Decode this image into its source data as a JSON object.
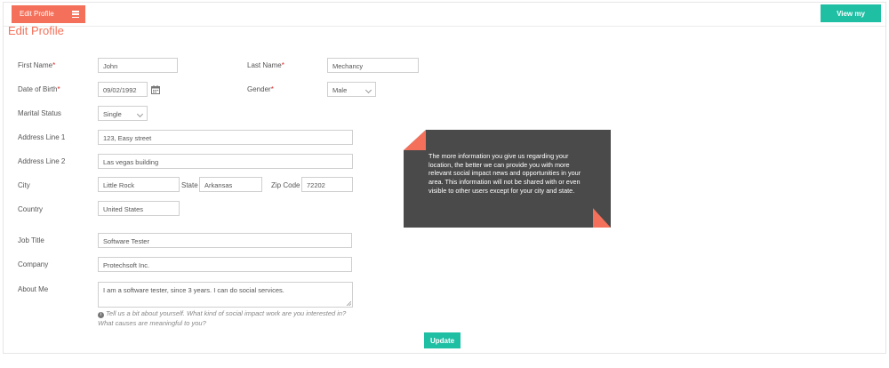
{
  "header": {
    "tab_label": "Edit Profile",
    "view_profile_label": "View my profile"
  },
  "page": {
    "title": "Edit Profile"
  },
  "form": {
    "first_name": {
      "label": "First Name",
      "value": "John"
    },
    "last_name": {
      "label": "Last Name",
      "value": "Mechancy"
    },
    "dob": {
      "label": "Date of Birth",
      "value": "09/02/1992"
    },
    "gender": {
      "label": "Gender",
      "value": "Male"
    },
    "marital": {
      "label": "Marital Status",
      "value": "Single"
    },
    "address1": {
      "label": "Address Line 1",
      "value": "123, Easy street"
    },
    "address2": {
      "label": "Address Line 2",
      "value": "Las vegas building"
    },
    "city": {
      "label": "City",
      "value": "Little Rock"
    },
    "state": {
      "label": "State",
      "value": "Arkansas"
    },
    "zip": {
      "label": "Zip Code",
      "value": "72202"
    },
    "country": {
      "label": "Country",
      "value": "United States"
    },
    "job_title": {
      "label": "Job Title",
      "value": "Software Tester"
    },
    "company": {
      "label": "Company",
      "value": "Protechsoft Inc."
    },
    "about": {
      "label": "About Me",
      "value": "I am a software tester, since 3 years. I can do social services."
    },
    "hint_line1": "Tell us a bit about yourself. What kind of social impact work are you interested in?",
    "hint_line2": "What causes are meaningful to you?",
    "required_mark": "*"
  },
  "note": {
    "text": "The more information you give us regarding your location, the better we can provide you with more relevant social impact news and opportunities in your area. This information will not be shared with or even visible to other users except for your city and state."
  },
  "actions": {
    "update_label": "Update"
  },
  "colors": {
    "accent": "#f4705a",
    "teal": "#1fbfa4",
    "note_bg": "#4a4a4a"
  }
}
